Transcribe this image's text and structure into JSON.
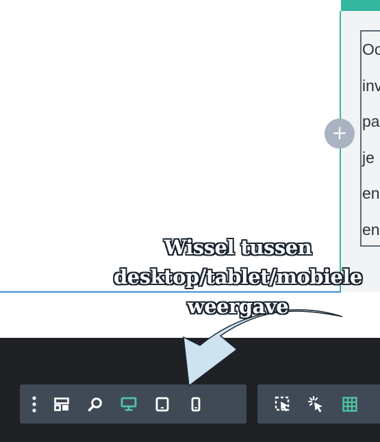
{
  "canvas": {
    "add_button_label": "+",
    "text_lines": [
      "Oo",
      "inv",
      "pa",
      "je",
      "en",
      "en"
    ]
  },
  "annotation": {
    "lines": [
      "Wissel tussen",
      "desktop/tablet/mobiele",
      "weergave"
    ]
  },
  "toolbar_left": {
    "items": [
      "more-options",
      "structure-navigator",
      "search",
      "desktop-view",
      "tablet-view",
      "mobile-view"
    ],
    "active_item": "desktop-view"
  },
  "toolbar_right": {
    "items": [
      "select-element",
      "click-interaction",
      "grid-view"
    ]
  },
  "colors": {
    "accent": "#35b79e",
    "active_icon": "#4fc4a3",
    "toolbar_bg": "#404a57",
    "bottom_bar_bg": "#1f2124",
    "selection_line": "#3d8fd6",
    "add_button_bg": "#a9b3c1"
  }
}
